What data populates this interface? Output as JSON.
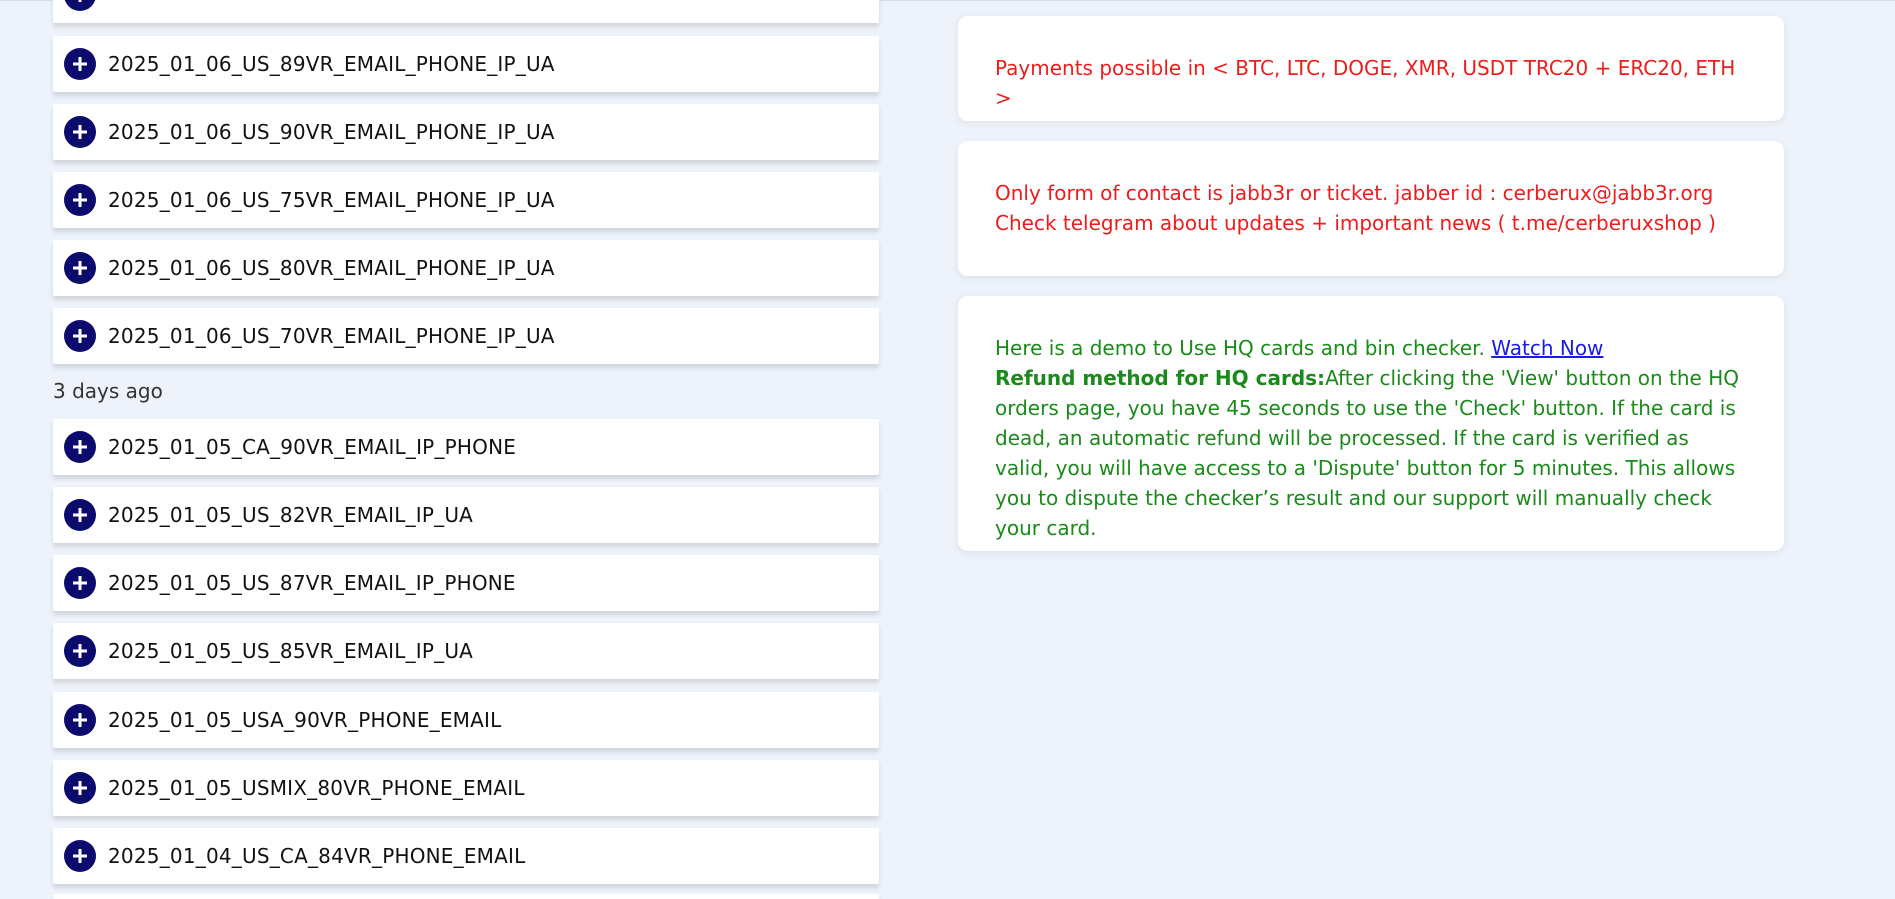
{
  "list": {
    "top_items": [
      {
        "label": "2025_01_06_US_89VR_EMAIL_PHONE_IP_UA"
      },
      {
        "label": "2025_01_06_US_90VR_EMAIL_PHONE_IP_UA"
      },
      {
        "label": "2025_01_06_US_75VR_EMAIL_PHONE_IP_UA"
      },
      {
        "label": "2025_01_06_US_80VR_EMAIL_PHONE_IP_UA"
      },
      {
        "label": "2025_01_06_US_70VR_EMAIL_PHONE_IP_UA"
      }
    ],
    "group_label": "3 days ago",
    "group_items": [
      {
        "label": "2025_01_05_CA_90VR_EMAIL_IP_PHONE"
      },
      {
        "label": "2025_01_05_US_82VR_EMAIL_IP_UA"
      },
      {
        "label": "2025_01_05_US_87VR_EMAIL_IP_PHONE"
      },
      {
        "label": "2025_01_05_US_85VR_EMAIL_IP_UA"
      },
      {
        "label": "2025_01_05_USA_90VR_PHONE_EMAIL"
      },
      {
        "label": "2025_01_05_USMIX_80VR_PHONE_EMAIL"
      },
      {
        "label": "2025_01_04_US_CA_84VR_PHONE_EMAIL"
      }
    ]
  },
  "payments": {
    "text": "Payments possible in < BTC, LTC, DOGE, XMR, USDT TRC20 + ERC20, ETH >"
  },
  "contact": {
    "line1": "Only form of contact is jabb3r or ticket. jabber id : cerberux@jabb3r.org",
    "line2": "Check telegram about updates + important news ( t.me/cerberuxshop )"
  },
  "demo": {
    "intro": "Here is a demo to Use HQ cards and bin checker. ",
    "link": "Watch Now",
    "refund_title": "Refund method for HQ cards:",
    "refund_text": "After clicking the 'View' button on the HQ orders page, you have 45 seconds to use the 'Check' button. If the card is dead, an automatic refund will be processed. If the card is verified as valid, you will have access to a 'Dispute' button for 5 minutes. This allows you to dispute the checker’s result and our support will manually check your card."
  },
  "colors": {
    "accent": "#0b0b6e",
    "warning_text": "#ee1c1c",
    "info_text": "#1a8a1a",
    "link": "#1a1aee",
    "background": "#eef2fa"
  },
  "icons": {
    "item_toggle": "plus-circle-icon"
  }
}
